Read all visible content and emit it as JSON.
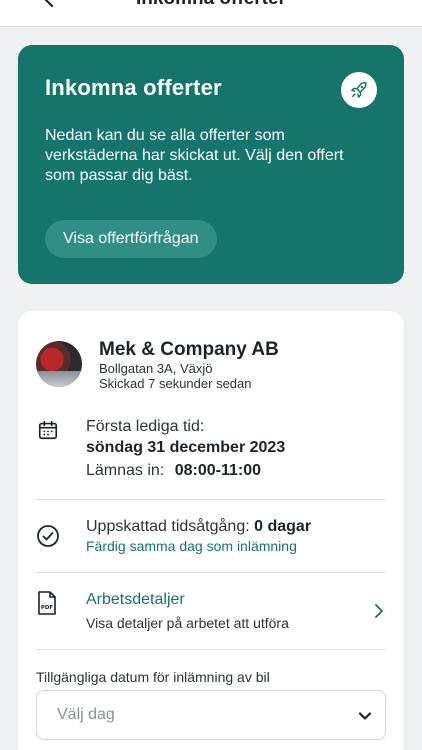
{
  "header": {
    "title": "Inkomna offerter"
  },
  "hero": {
    "title": "Inkomna offerter",
    "description": "Nedan kan du se alla offerter som verkstäderna har skickat ut. Välj den offert som passar dig bäst.",
    "button_label": "Visa offertförfrågan",
    "icon": "rocket-icon"
  },
  "offer": {
    "company": "Mek & Company AB",
    "address": "Bollgatan 3A, Växjö",
    "sent": "Skickad 7 sekunder sedan",
    "first_available_label": "Första lediga tid:",
    "first_available_date": "söndag 31 december 2023",
    "dropoff_label": "Lämnas in:",
    "dropoff_time": "08:00-11:00",
    "estimate_label": "Uppskattad tidsåtgång:",
    "estimate_value": "0 dagar",
    "estimate_note": "Färdig samma dag som inlämning",
    "details_title": "Arbetsdetaljer",
    "details_sub": "Visa detaljer på arbetet att utföra",
    "dates_label": "Tillgängliga datum för inlämning av bil",
    "date_placeholder": "Välj dag"
  },
  "colors": {
    "accent": "#16756a",
    "background": "#f0f1f3"
  }
}
